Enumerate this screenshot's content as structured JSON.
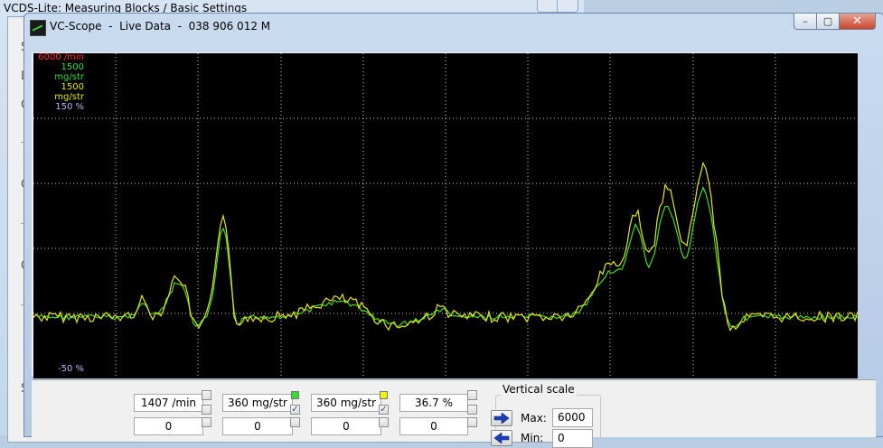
{
  "background_window": {
    "title": "VCDS-Lite: Measuring Blocks / Basic Settings",
    "letters": [
      "S",
      "L",
      "G",
      "G",
      "G",
      "S"
    ]
  },
  "window": {
    "title": "VC-Scope  -  Live Data  -  038 906 012 M",
    "buttons": {
      "minimize": "–",
      "maximize": "▢",
      "close": "✕"
    }
  },
  "scope": {
    "legend": [
      {
        "text": "6000 /min",
        "color": "#ff2a2a"
      },
      {
        "text": "1500 mg/str",
        "color": "#3cdc3c"
      },
      {
        "text": "1500 mg/str",
        "color": "#e8e800"
      },
      {
        "text": "150 %",
        "color": "#b8b8ff"
      }
    ],
    "bottom_label": {
      "text": "-50 %",
      "color": "#b8b8ff"
    },
    "colors": {
      "background": "#000000",
      "grid": "#cfcfcf",
      "series_green": "#44dd22",
      "series_yellow": "#e6e614"
    }
  },
  "channels": [
    {
      "value": "1407 /min",
      "reset": "0",
      "color": null,
      "checked": false
    },
    {
      "value": "360 mg/str",
      "reset": "0",
      "color": "#33dd33",
      "checked": true
    },
    {
      "value": "360 mg/str",
      "reset": "0",
      "color": "#f4f400",
      "checked": true
    },
    {
      "value": "36.7 %",
      "reset": "0",
      "color": null,
      "checked": false
    }
  ],
  "vertical_scale": {
    "label": "Vertical scale",
    "max_label": "Max:",
    "max_value": "6000",
    "min_label": "Min:",
    "min_value": "0"
  }
}
